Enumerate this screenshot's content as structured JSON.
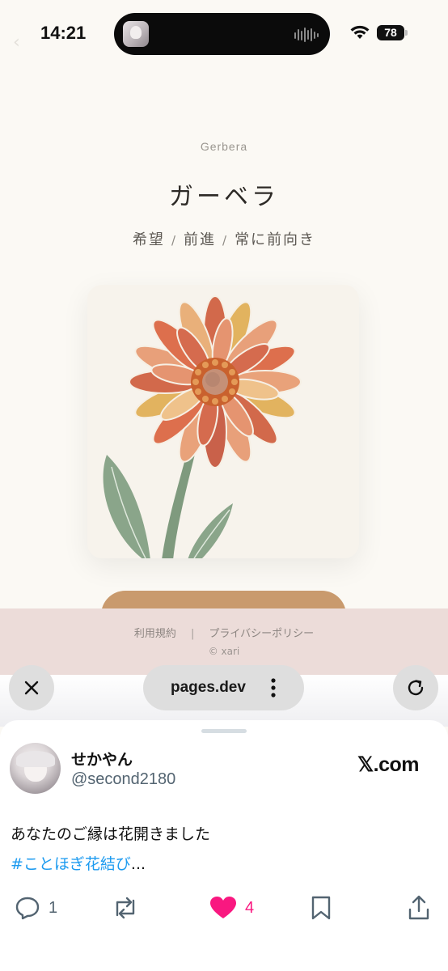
{
  "status_bar": {
    "time": "14:21",
    "battery": "78"
  },
  "page": {
    "flower_name_en": "Gerbera",
    "flower_name_jp": "ガーベラ",
    "meanings": [
      "希望",
      "前進",
      "常に前向き"
    ],
    "meaning_separator": "/"
  },
  "footer": {
    "terms": "利用規約",
    "divider": "|",
    "privacy": "プライバシーポリシー",
    "copyright": "© xari"
  },
  "browser": {
    "url": "pages.dev"
  },
  "share": {
    "display_name": "せかやん",
    "handle": "@second2180",
    "brand": "𝕏.com",
    "text": "あなたのご縁は花開きました",
    "hashtag": "#ことほぎ花結び",
    "ellipsis": "...",
    "reply_count": "1",
    "like_count": "4",
    "like_color": "#f91880",
    "link_color": "#1d9bf0",
    "icons": [
      "reply-icon",
      "repost-icon",
      "heart-icon",
      "bookmark-icon",
      "share-icon"
    ]
  }
}
